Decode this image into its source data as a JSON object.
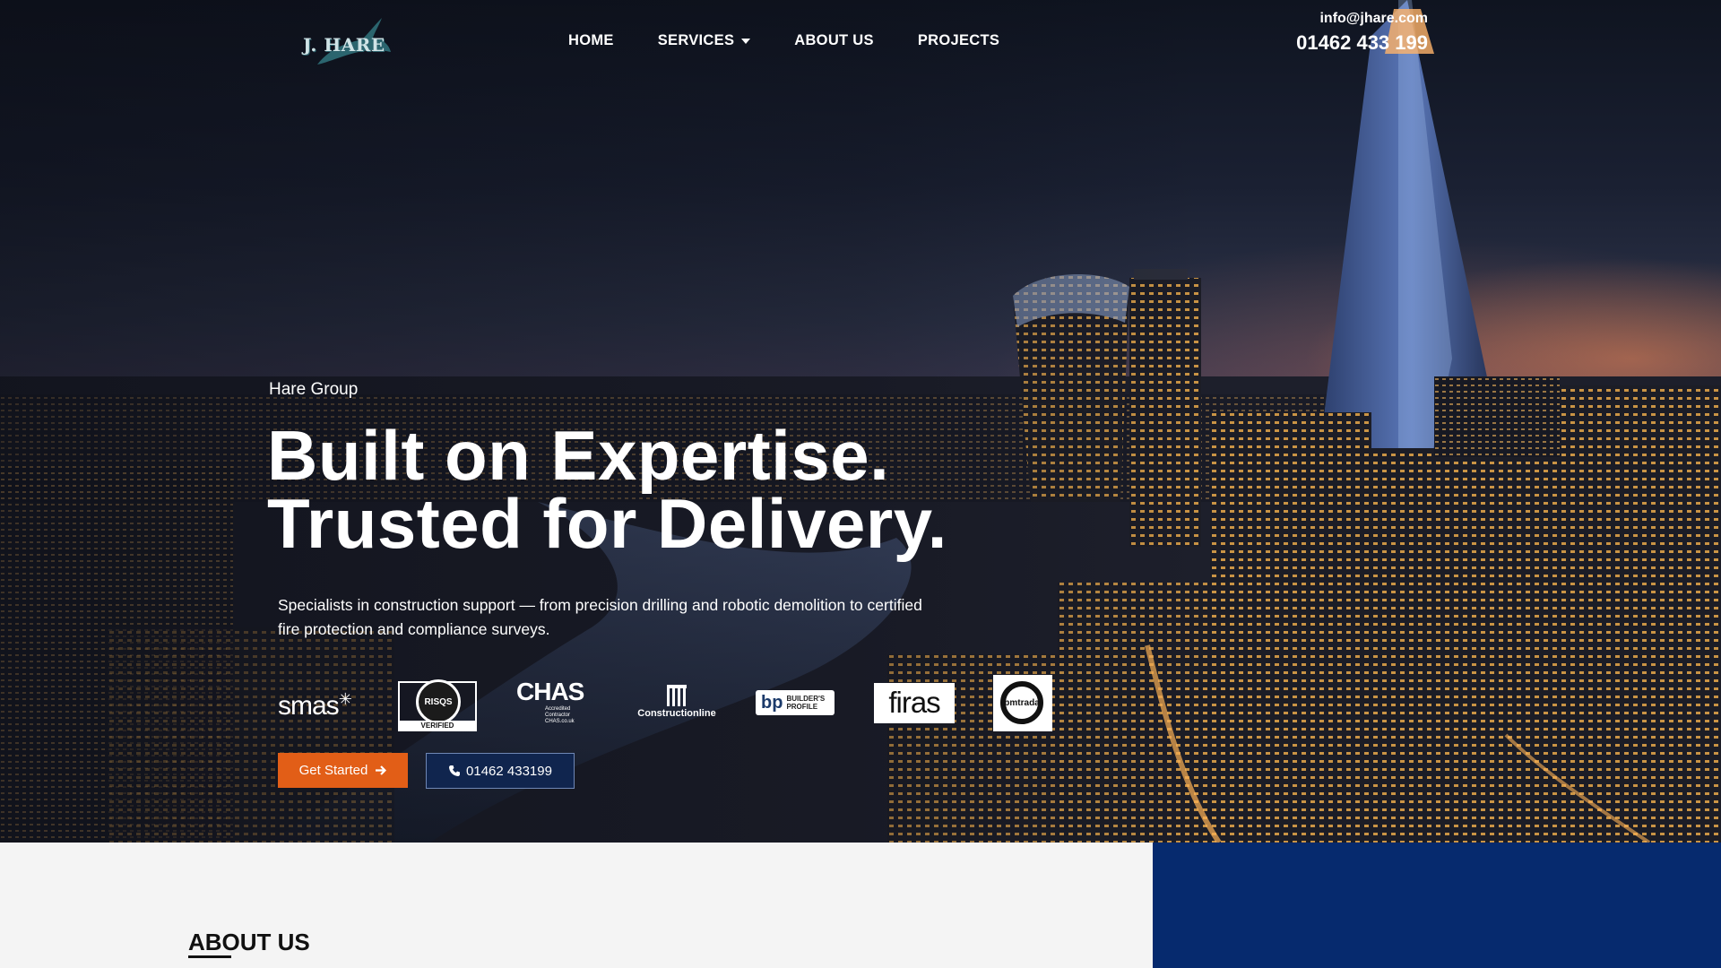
{
  "header": {
    "logo_text": "J. HARE",
    "nav": [
      {
        "label": "HOME"
      },
      {
        "label": "SERVICES",
        "has_dropdown": true
      },
      {
        "label": "ABOUT US"
      },
      {
        "label": "PROJECTS"
      }
    ],
    "contact": {
      "email": "info@jhare.com",
      "phone": "01462 433 199"
    }
  },
  "hero": {
    "eyebrow": "Hare Group",
    "headline_line1": "Built on Expertise.",
    "headline_line2": "Trusted for Delivery.",
    "subtext": "Specialists in construction support — from precision drilling and robotic demolition to certified fire protection and compliance surveys.",
    "badges": {
      "smas": "smas",
      "risqs": "RISQS",
      "risqs_verified": "VERIFIED",
      "chas": "CHAS",
      "chas_sub": "Accredited Contractor CHAS.co.uk",
      "constructionline": "Constructionline",
      "builders_profile": "BUILDER'S PROFILE",
      "firas": "firas",
      "bmtrada": "bmtrada"
    },
    "buttons": {
      "primary": "Get Started",
      "secondary": "01462 433199"
    }
  },
  "about": {
    "title": "ABOUT US"
  },
  "colors": {
    "accent_orange": "#e25e17",
    "navy": "#062a6e",
    "secondary_button": "#10254e"
  }
}
